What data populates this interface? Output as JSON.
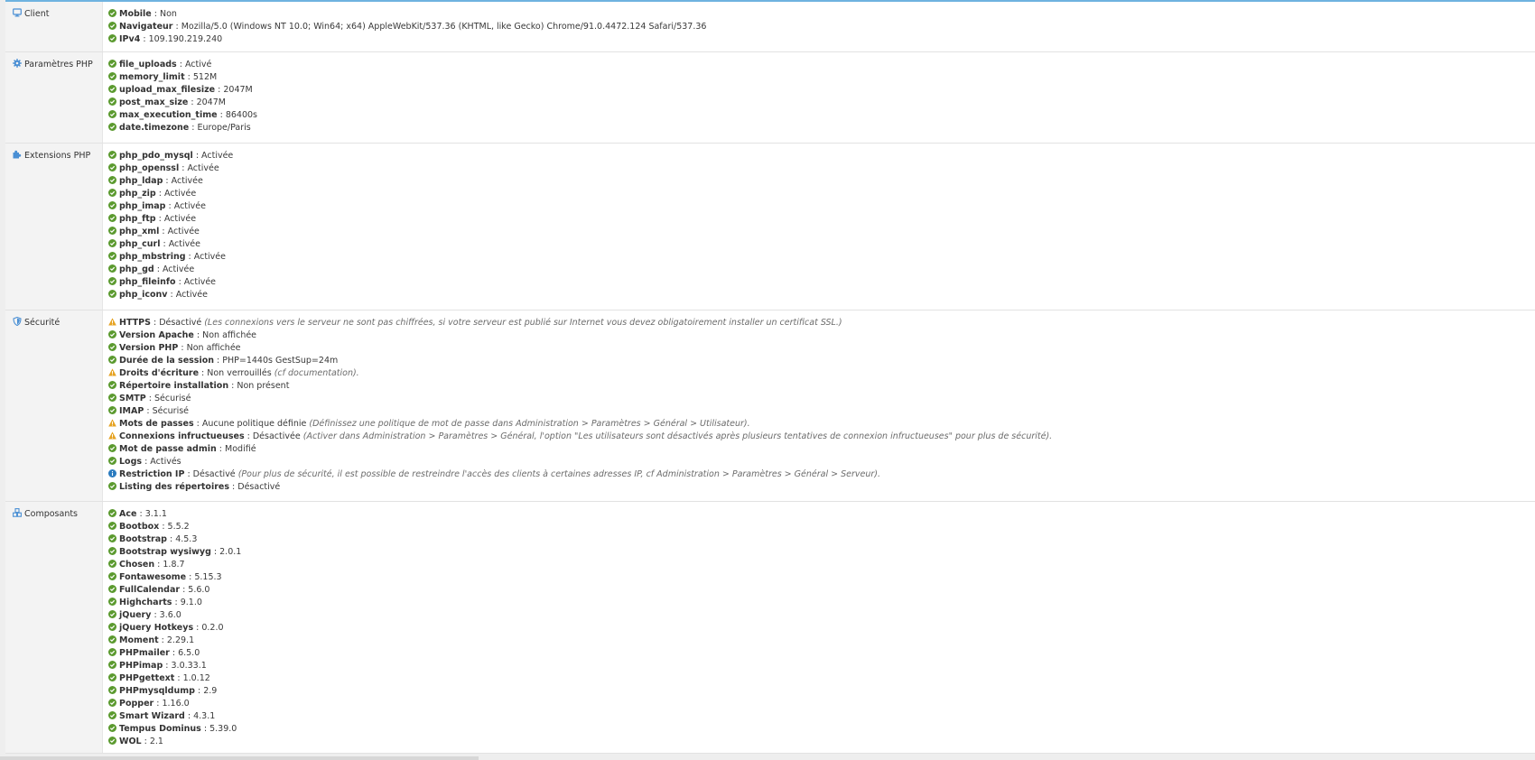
{
  "colors": {
    "ok": "#5b9a2f",
    "warn": "#e6a323",
    "info": "#2a7bbf",
    "accent": "#4a8fd4"
  },
  "sections": [
    {
      "key": "client",
      "label": "Client",
      "icon": "monitor-icon",
      "items": [
        {
          "status": "ok",
          "key": "Mobile",
          "value": "Non"
        },
        {
          "status": "ok",
          "key": "Navigateur",
          "value": "Mozilla/5.0 (Windows NT 10.0; Win64; x64) AppleWebKit/537.36 (KHTML, like Gecko) Chrome/91.0.4472.124 Safari/537.36"
        },
        {
          "status": "ok",
          "key": "IPv4",
          "value": "109.190.219.240"
        }
      ]
    },
    {
      "key": "php",
      "label": "Paramètres PHP",
      "icon": "gear-icon",
      "items": [
        {
          "status": "ok",
          "key": "file_uploads",
          "value": "Activé"
        },
        {
          "status": "ok",
          "key": "memory_limit",
          "value": "512M"
        },
        {
          "status": "ok",
          "key": "upload_max_filesize",
          "value": "2047M"
        },
        {
          "status": "ok",
          "key": "post_max_size",
          "value": "2047M"
        },
        {
          "status": "ok",
          "key": "max_execution_time",
          "value": "86400s"
        },
        {
          "status": "ok",
          "key": "date.timezone",
          "value": "Europe/Paris"
        }
      ]
    },
    {
      "key": "extensions",
      "label": "Extensions PHP",
      "icon": "puzzle-icon",
      "items": [
        {
          "status": "ok",
          "key": "php_pdo_mysql",
          "value": "Activée"
        },
        {
          "status": "ok",
          "key": "php_openssl",
          "value": "Activée"
        },
        {
          "status": "ok",
          "key": "php_ldap",
          "value": "Activée"
        },
        {
          "status": "ok",
          "key": "php_zip",
          "value": "Activée"
        },
        {
          "status": "ok",
          "key": "php_imap",
          "value": "Activée"
        },
        {
          "status": "ok",
          "key": "php_ftp",
          "value": "Activée"
        },
        {
          "status": "ok",
          "key": "php_xml",
          "value": "Activée"
        },
        {
          "status": "ok",
          "key": "php_curl",
          "value": "Activée"
        },
        {
          "status": "ok",
          "key": "php_mbstring",
          "value": "Activée"
        },
        {
          "status": "ok",
          "key": "php_gd",
          "value": "Activée"
        },
        {
          "status": "ok",
          "key": "php_fileinfo",
          "value": "Activée"
        },
        {
          "status": "ok",
          "key": "php_iconv",
          "value": "Activée"
        }
      ]
    },
    {
      "key": "securite",
      "label": "Sécurité",
      "icon": "shield-icon",
      "items": [
        {
          "status": "warn",
          "key": "HTTPS",
          "value": "Désactivé",
          "note": "(Les connexions vers le serveur ne sont pas chiffrées, si votre serveur est publié sur Internet vous devez obligatoirement installer un certificat SSL.)"
        },
        {
          "status": "ok",
          "key": "Version Apache",
          "value": "Non affichée"
        },
        {
          "status": "ok",
          "key": "Version PHP",
          "value": "Non affichée"
        },
        {
          "status": "ok",
          "key": "Durée de la session",
          "value": "PHP=1440s GestSup=24m"
        },
        {
          "status": "warn",
          "key": "Droits d'écriture",
          "value": "Non verrouillés",
          "note": "(cf documentation)."
        },
        {
          "status": "ok",
          "key": "Répertoire installation",
          "value": "Non présent"
        },
        {
          "status": "ok",
          "key": "SMTP",
          "value": "Sécurisé"
        },
        {
          "status": "ok",
          "key": "IMAP",
          "value": "Sécurisé"
        },
        {
          "status": "warn",
          "key": "Mots de passes",
          "value": "Aucune politique définie",
          "note": "(Définissez une politique de mot de passe dans Administration > Paramètres > Général > Utilisateur)."
        },
        {
          "status": "warn",
          "key": "Connexions infructueuses",
          "value": "Désactivée",
          "note": "(Activer dans Administration > Paramètres > Général, l'option \"Les utilisateurs sont désactivés après plusieurs tentatives de connexion infructueuses\" pour plus de sécurité)."
        },
        {
          "status": "ok",
          "key": "Mot de passe admin",
          "value": "Modifié"
        },
        {
          "status": "ok",
          "key": "Logs",
          "value": "Activés"
        },
        {
          "status": "info",
          "key": "Restriction IP",
          "value": "Désactivé",
          "note": "(Pour plus de sécurité, il est possible de restreindre l'accès des clients à certaines adresses IP, cf Administration > Paramètres > Général > Serveur)."
        },
        {
          "status": "ok",
          "key": "Listing des répertoires",
          "value": "Désactivé"
        }
      ]
    },
    {
      "key": "composants",
      "label": "Composants",
      "icon": "cubes-icon",
      "items": [
        {
          "status": "ok",
          "key": "Ace",
          "value": "3.1.1"
        },
        {
          "status": "ok",
          "key": "Bootbox",
          "value": "5.5.2"
        },
        {
          "status": "ok",
          "key": "Bootstrap",
          "value": "4.5.3"
        },
        {
          "status": "ok",
          "key": "Bootstrap wysiwyg",
          "value": "2.0.1"
        },
        {
          "status": "ok",
          "key": "Chosen",
          "value": "1.8.7"
        },
        {
          "status": "ok",
          "key": "Fontawesome",
          "value": "5.15.3"
        },
        {
          "status": "ok",
          "key": "FullCalendar",
          "value": "5.6.0"
        },
        {
          "status": "ok",
          "key": "Highcharts",
          "value": "9.1.0"
        },
        {
          "status": "ok",
          "key": "jQuery",
          "value": "3.6.0"
        },
        {
          "status": "ok",
          "key": "jQuery Hotkeys",
          "value": "0.2.0"
        },
        {
          "status": "ok",
          "key": "Moment",
          "value": "2.29.1"
        },
        {
          "status": "ok",
          "key": "PHPmailer",
          "value": "6.5.0"
        },
        {
          "status": "ok",
          "key": "PHPimap",
          "value": "3.0.33.1"
        },
        {
          "status": "ok",
          "key": "PHPgettext",
          "value": "1.0.12"
        },
        {
          "status": "ok",
          "key": "PHPmysqldump",
          "value": "2.9"
        },
        {
          "status": "ok",
          "key": "Popper",
          "value": "1.16.0"
        },
        {
          "status": "ok",
          "key": "Smart Wizard",
          "value": "4.3.1"
        },
        {
          "status": "ok",
          "key": "Tempus Dominus",
          "value": "5.39.0"
        },
        {
          "status": "ok",
          "key": "WOL",
          "value": "2.1"
        }
      ]
    }
  ]
}
